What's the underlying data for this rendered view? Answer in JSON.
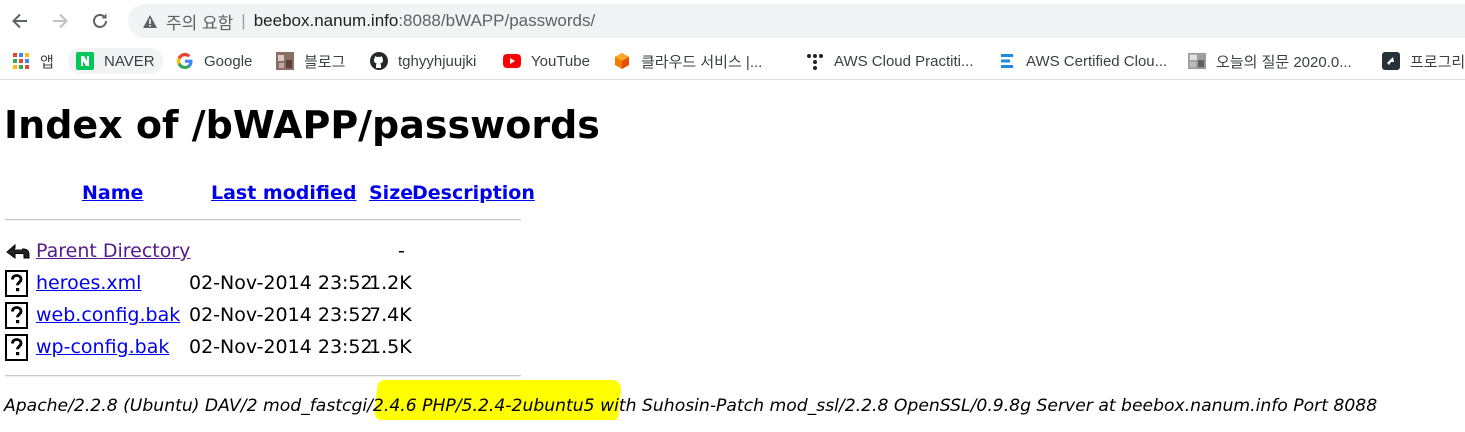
{
  "browser": {
    "security_label": "주의 요함",
    "url_host": "beebox.nanum.info",
    "url_port_path": ":8088/bWAPP/passwords/",
    "bookmarks": [
      {
        "label": "앱",
        "icon": "apps-grid-icon"
      },
      {
        "label": "NAVER",
        "icon": "naver-icon"
      },
      {
        "label": "Google",
        "icon": "google-icon"
      },
      {
        "label": "블로그",
        "icon": "blog-thumbnail-icon"
      },
      {
        "label": "tghyyhjuujki",
        "icon": "github-icon"
      },
      {
        "label": "YouTube",
        "icon": "youtube-icon"
      },
      {
        "label": "클라우드 서비스 |...",
        "icon": "cloud-cube-icon"
      },
      {
        "label": "AWS Cloud Practiti...",
        "icon": "aws-dots-icon"
      },
      {
        "label": "AWS Certified Clou...",
        "icon": "aws-bars-icon"
      },
      {
        "label": "오늘의 질문 2020.0...",
        "icon": "question-thumbnail-icon"
      },
      {
        "label": "프로그리",
        "icon": "programmers-icon"
      }
    ]
  },
  "page": {
    "title": "Index of /bWAPP/passwords",
    "columns": {
      "name": "Name",
      "last_modified": "Last modified",
      "size": "Size",
      "description": "Description"
    },
    "rows": [
      {
        "name": "Parent Directory",
        "modified": "",
        "size": "-",
        "icon": "back-folder-icon"
      },
      {
        "name": "heroes.xml",
        "modified": "02-Nov-2014 23:52",
        "size": "1.2K",
        "icon": "unknown-file-icon"
      },
      {
        "name": "web.config.bak",
        "modified": "02-Nov-2014 23:52",
        "size": "7.4K",
        "icon": "unknown-file-icon"
      },
      {
        "name": "wp-config.bak",
        "modified": "02-Nov-2014 23:52",
        "size": "1.5K",
        "icon": "unknown-file-icon"
      }
    ],
    "server_signature": "Apache/2.2.8 (Ubuntu) DAV/2 mod_fastcgi/2.4.6 PHP/5.2.4-2ubuntu5 with Suhosin-Patch mod_ssl/2.2.8 OpenSSL/0.9.8g Server at beebox.nanum.info Port 8088"
  },
  "colors": {
    "link": "#0000ee",
    "visited_link": "#551a8b",
    "highlight": "#ffff00",
    "omnibox_bg": "#f1f3f4"
  }
}
